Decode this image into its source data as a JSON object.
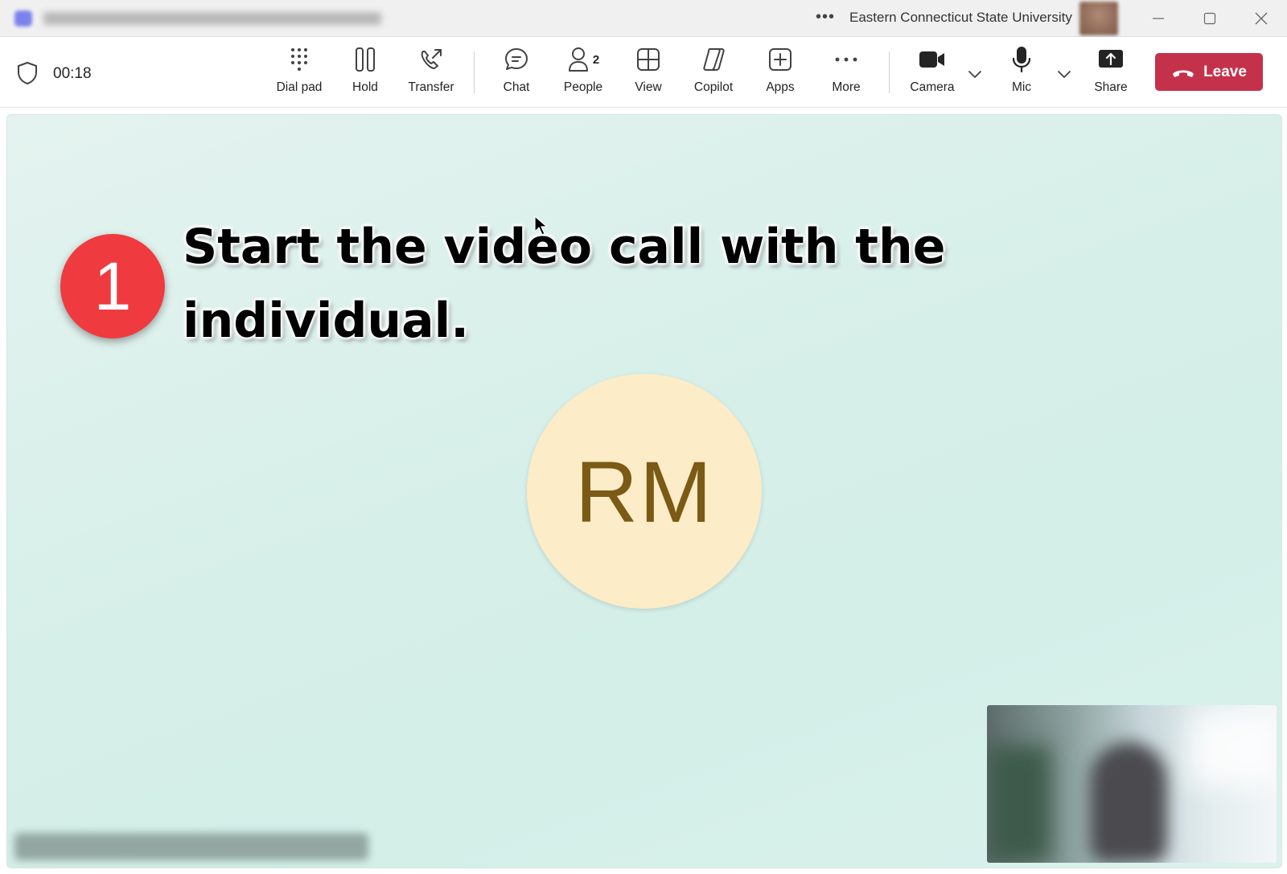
{
  "titlebar": {
    "more_icon": "ellipsis-icon",
    "org_name": "Eastern Connecticut State University",
    "minimize_icon": "minimize-icon",
    "maximize_icon": "maximize-icon",
    "close_icon": "close-icon"
  },
  "toolbar": {
    "timer": "00:18",
    "buttons": {
      "dialpad": "Dial pad",
      "hold": "Hold",
      "transfer": "Transfer",
      "chat": "Chat",
      "people": "People",
      "people_count": "2",
      "view": "View",
      "copilot": "Copilot",
      "apps": "Apps",
      "more": "More",
      "camera": "Camera",
      "mic": "Mic",
      "share": "Share"
    },
    "leave_label": "Leave",
    "leave_color": "#c4314b"
  },
  "stage": {
    "step_number": "1",
    "instruction": "Start the video call with the individual.",
    "participant_initials": "RM",
    "step_color": "#ef3b3f",
    "avatar_color": "#fcecc8"
  }
}
